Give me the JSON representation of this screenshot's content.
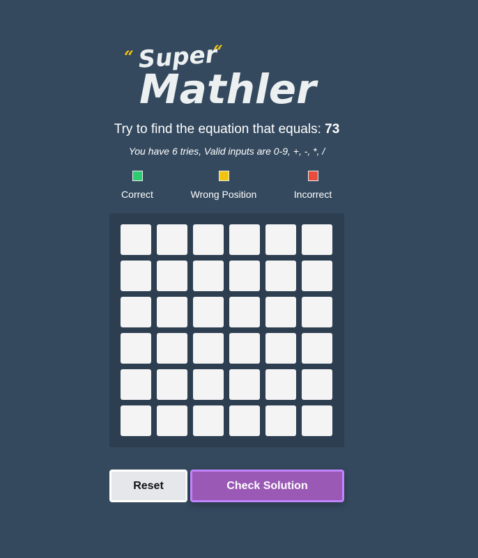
{
  "logo": {
    "open_quote": "“",
    "close_quote": "“",
    "super": "Super",
    "mathler": "Mathler"
  },
  "instructions": {
    "prompt": "Try to find the equation that equals: ",
    "target": "73",
    "hint": "You have 6 tries, Valid inputs are 0-9, +, -, *, /"
  },
  "legend": [
    {
      "label": "Correct",
      "color": "#2ecc71"
    },
    {
      "label": "Wrong Position",
      "color": "#f1c40f"
    },
    {
      "label": "Incorrect",
      "color": "#e74c3c"
    }
  ],
  "board": {
    "rows": [
      [
        "",
        "",
        "",
        "",
        "",
        ""
      ],
      [
        "",
        "",
        "",
        "",
        "",
        ""
      ],
      [
        "",
        "",
        "",
        "",
        "",
        ""
      ],
      [
        "",
        "",
        "",
        "",
        "",
        ""
      ],
      [
        "",
        "",
        "",
        "",
        "",
        ""
      ],
      [
        "",
        "",
        "",
        "",
        "",
        ""
      ]
    ]
  },
  "buttons": {
    "reset": "Reset",
    "check": "Check Solution"
  },
  "colors": {
    "background": "#34495e",
    "board": "#2c3e50",
    "cell": "#f4f4f5",
    "accent": "#9b59b6"
  }
}
